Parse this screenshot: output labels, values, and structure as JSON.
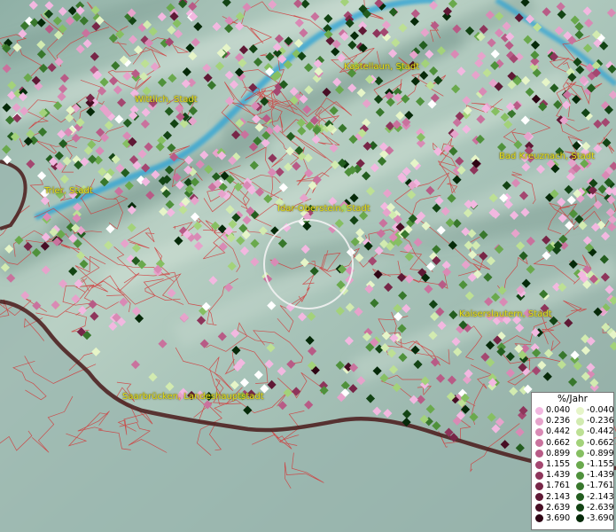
{
  "map": {
    "cities": [
      {
        "name": "Kastellaun, Stadt",
        "id": "kastellaun"
      },
      {
        "name": "Wittlich, Stadt",
        "id": "wittlich"
      },
      {
        "name": "Bad Kreuznach, Stadt",
        "id": "bad-kreuznach"
      },
      {
        "name": "Trier, Stadt",
        "id": "trier"
      },
      {
        "name": "Idar-Oberstein, Stadt",
        "id": "idar-oberstein"
      },
      {
        "name": "Kaiserslautern, Stadt",
        "id": "kaiserslautern"
      },
      {
        "name": "Saarbrücken, Landeshauptstadt",
        "id": "saarbruecken"
      }
    ],
    "colors": {
      "boundary": "#d23a3a",
      "state_border": "#4a1a1a",
      "river": "#2aa3d6",
      "terrain_light": "#b9d1c6",
      "terrain_dark": "#7f9e95"
    }
  },
  "legend": {
    "title": "%/Jahr",
    "positive": [
      {
        "value": "0.040",
        "color": "#f2b8e0"
      },
      {
        "value": "0.236",
        "color": "#e6a3cb"
      },
      {
        "value": "0.442",
        "color": "#d98ab5"
      },
      {
        "value": "0.662",
        "color": "#c9729d"
      },
      {
        "value": "0.899",
        "color": "#b85b86"
      },
      {
        "value": "1.155",
        "color": "#a44770"
      },
      {
        "value": "1.439",
        "color": "#8e355b"
      },
      {
        "value": "1.761",
        "color": "#772647"
      },
      {
        "value": "2.143",
        "color": "#5f1935"
      },
      {
        "value": "2.639",
        "color": "#470e24"
      },
      {
        "value": "3.690",
        "color": "#2e0514"
      }
    ],
    "negative": [
      {
        "value": "-0.040",
        "color": "#e6f5c8"
      },
      {
        "value": "-0.236",
        "color": "#d2ebb0"
      },
      {
        "value": "-0.442",
        "color": "#bde094"
      },
      {
        "value": "-0.662",
        "color": "#a3d27a"
      },
      {
        "value": "-0.899",
        "color": "#86bf62"
      },
      {
        "value": "-1.155",
        "color": "#6aa94d"
      },
      {
        "value": "-1.439",
        "color": "#4f913b"
      },
      {
        "value": "-1.761",
        "color": "#38772c"
      },
      {
        "value": "-2.143",
        "color": "#235d1f"
      },
      {
        "value": "-2.639",
        "color": "#134414"
      },
      {
        "value": "-3.690",
        "color": "#062a09"
      }
    ]
  }
}
